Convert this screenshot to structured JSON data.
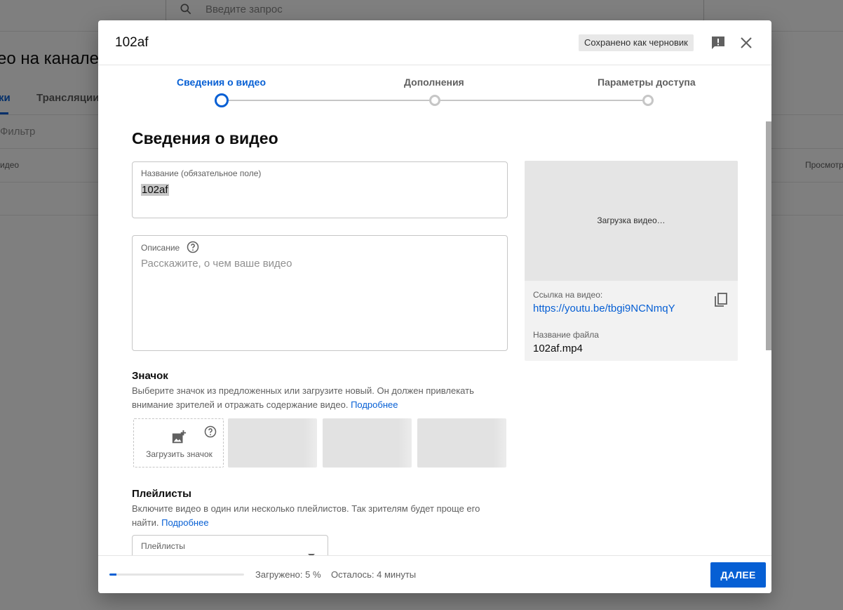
{
  "background": {
    "search_placeholder": "Введите запрос",
    "heading": "ео на канале",
    "tabs": [
      "ки",
      "Трансляции"
    ],
    "filter_label": "Фильтр",
    "columns": [
      "идео",
      "Просмотр"
    ]
  },
  "dialog": {
    "title": "102af",
    "draft_badge": "Сохранено как черновик",
    "steps": [
      {
        "label": "Сведения о видео",
        "active": true
      },
      {
        "label": "Дополнения",
        "active": false
      },
      {
        "label": "Параметры доступа",
        "active": false
      }
    ],
    "section_title": "Сведения о видео",
    "title_field": {
      "label": "Название (обязательное поле)",
      "value": "102af"
    },
    "description_field": {
      "label": "Описание",
      "placeholder": "Расскажите, о чем ваше видео"
    },
    "thumbnail": {
      "title": "Значок",
      "description": "Выберите значок из предложенных или загрузите новый. Он должен привлекать внимание зрителей и отражать содержание видео.",
      "learn_more": "Подробнее",
      "upload_label": "Загрузить значок"
    },
    "playlists": {
      "title": "Плейлисты",
      "description": "Включите видео в один или несколько плейлистов. Так зрителям будет проще его найти.",
      "learn_more": "Подробнее",
      "field_label": "Плейлисты"
    },
    "preview": {
      "loading": "Загрузка видео…",
      "link_label": "Ссылка на видео:",
      "link_value": "https://youtu.be/tbgi9NCNmqY",
      "file_label": "Название файла",
      "file_value": "102af.mp4"
    },
    "footer": {
      "upload_status": "Загружено: 5 %",
      "upload_progress": 0.05,
      "remaining": "Осталось: 4 минуты",
      "next_button": "ДАЛЕЕ"
    }
  },
  "colors": {
    "accent": "#065fd4",
    "scrim": "rgba(0,0,0,0.5)"
  }
}
